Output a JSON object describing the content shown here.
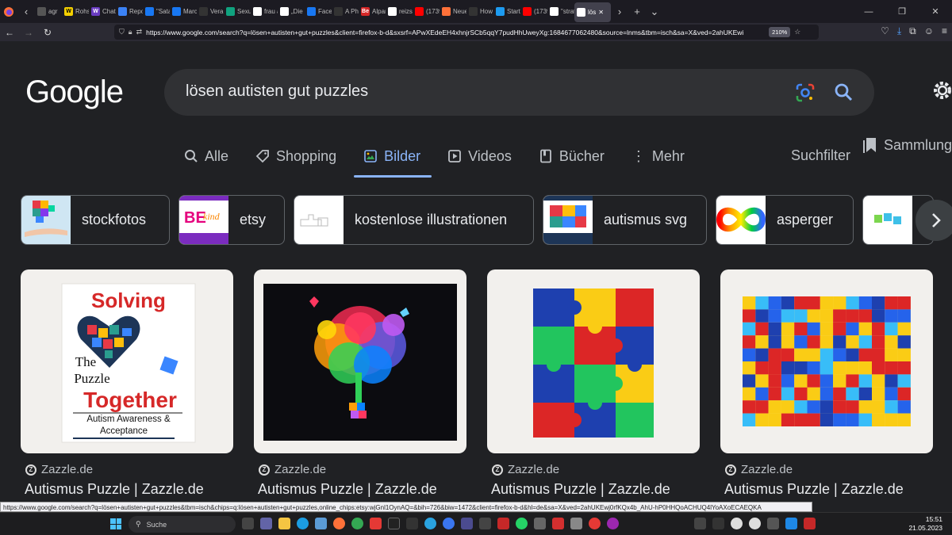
{
  "browser": {
    "tabs": [
      {
        "label": "agr",
        "color": "#555"
      },
      {
        "label": "Rohst",
        "color": "#f4d000",
        "glyph": "W"
      },
      {
        "label": "Chatb",
        "color": "#6a3cc1",
        "glyph": "W"
      },
      {
        "label": "Repor",
        "color": "#3b82f6"
      },
      {
        "label": "\"Sata",
        "color": "#1877f2"
      },
      {
        "label": "Marc",
        "color": "#1877f2"
      },
      {
        "label": "Vera I",
        "color": "#333"
      },
      {
        "label": "Sexua",
        "color": "#10a37f"
      },
      {
        "label": "frau a",
        "color": "#fff"
      },
      {
        "label": "„Die Frau",
        "color": "#fff"
      },
      {
        "label": "Faceb",
        "color": "#1877f2"
      },
      {
        "label": "A Phe",
        "color": "#333"
      },
      {
        "label": "Alpar",
        "color": "#d62828",
        "glyph": "Be"
      },
      {
        "label": "reizst",
        "color": "#fff"
      },
      {
        "label": "(1739",
        "color": "#ff0000"
      },
      {
        "label": "Neue",
        "color": "#ff7139"
      },
      {
        "label": "How t",
        "color": "#333"
      },
      {
        "label": "Starts",
        "color": "#1d9bf0"
      },
      {
        "label": "(1739",
        "color": "#ff0000"
      },
      {
        "label": "\"strat",
        "color": "#fff"
      },
      {
        "label": "lös",
        "color": "#fff",
        "active": true
      }
    ],
    "url": "https://www.google.com/search?q=lösen+autisten+gut+puzzles&client=firefox-b-d&sxsrf=APwXEdeEH4xhnjrSCb5qqY7pudHhUweyXg:1684677062480&source=lnms&tbm=isch&sa=X&ved=2ahUKEwi",
    "zoom": "210%"
  },
  "google": {
    "logo": "Google",
    "query": "lösen autisten gut puzzles",
    "tabs": [
      {
        "label": "Alle",
        "icon": "search-icon"
      },
      {
        "label": "Shopping",
        "icon": "tag-icon"
      },
      {
        "label": "Bilder",
        "icon": "image-icon",
        "active": true
      },
      {
        "label": "Videos",
        "icon": "play-icon"
      },
      {
        "label": "Bücher",
        "icon": "book-icon"
      },
      {
        "label": "Mehr",
        "icon": "more-icon"
      }
    ],
    "suchfilter": "Suchfilter",
    "sammlungen": "Sammlungen",
    "chips": [
      {
        "label": "stockfotos"
      },
      {
        "label": "etsy"
      },
      {
        "label": "kostenlose illustrationen"
      },
      {
        "label": "autismus svg"
      },
      {
        "label": "asperger"
      },
      {
        "label": ""
      }
    ],
    "results": [
      {
        "source": "Zazzle.de",
        "title": "Autismus Puzzle | Zazzle.de",
        "image_text": [
          "Solving",
          "The",
          "Puzzle",
          "Together",
          "Autism Awareness &",
          "Acceptance"
        ]
      },
      {
        "source": "Zazzle.de",
        "title": "Autismus Puzzle | Zazzle.de"
      },
      {
        "source": "Zazzle.de",
        "title": "Autismus Puzzle | Zazzle.de"
      },
      {
        "source": "Zazzle.de",
        "title": "Autismus Puzzle | Zazzle.de"
      }
    ]
  },
  "status_url": "https://www.google.com/search?q=lösen+autisten+gut+puzzles&tbm=isch&chips=q:lösen+autisten+gut+puzzles,online_chips:etsy:wjGnl1OynAQ=&bih=726&biw=1472&client=firefox-b-d&hl=de&sa=X&ved=2ahUKEwj0rfKQx4b_AhU-hP0HHQoACHUQ4lYoAXoECAEQKA",
  "taskbar": {
    "search_label": "Suche",
    "time": "15:51",
    "date": "21.05.2023"
  }
}
